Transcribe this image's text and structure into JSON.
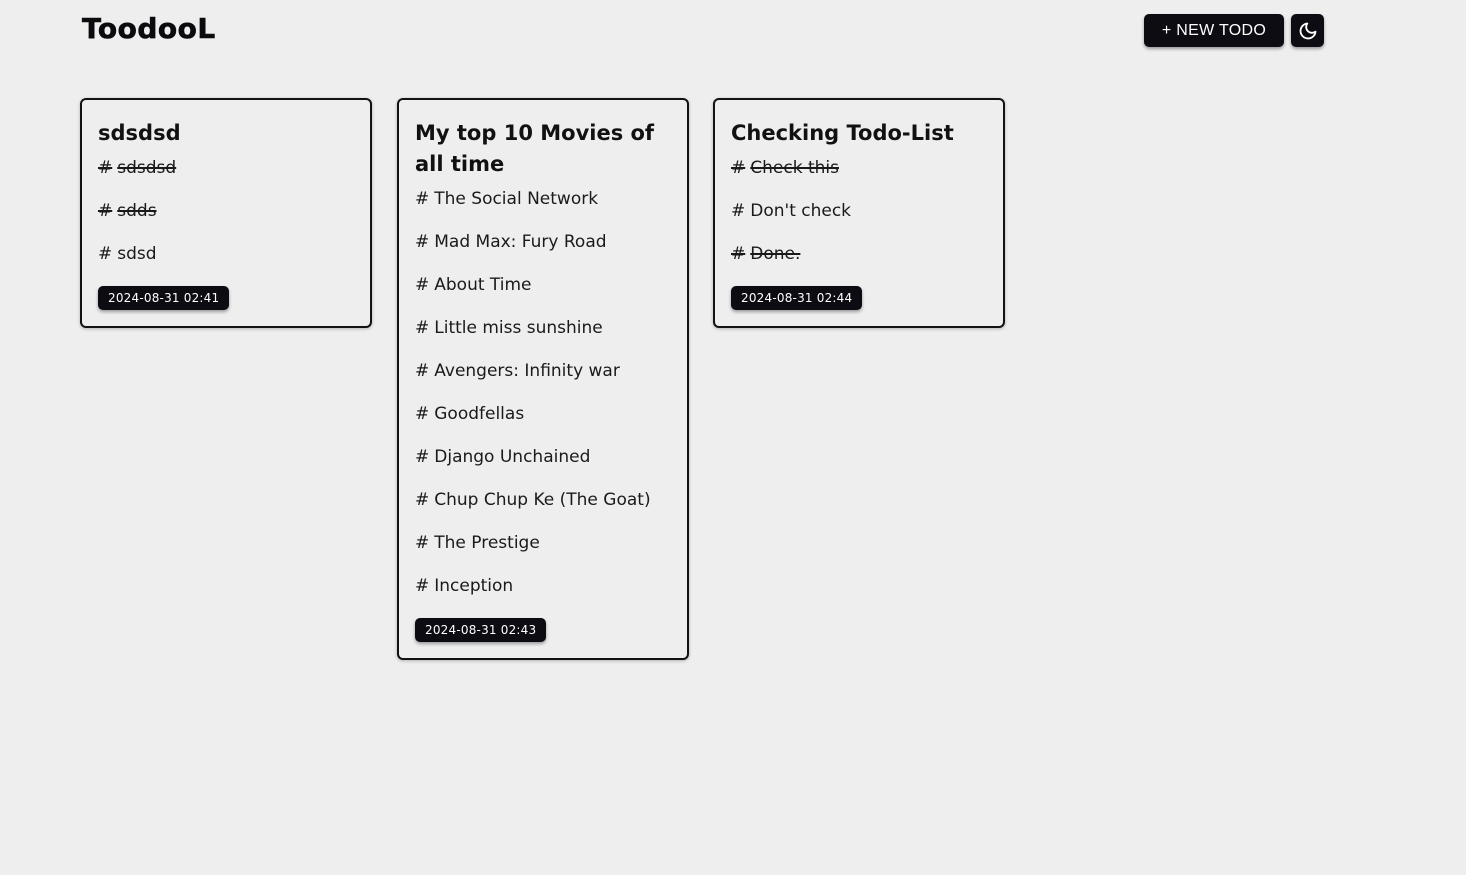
{
  "app": {
    "title": "ToodooL"
  },
  "header": {
    "new_todo_label": "+ NEW TODO",
    "theme_toggle_icon": "moon-icon"
  },
  "colors": {
    "background": "#eeeeee",
    "button_bg": "#0d0c12",
    "text": "#111111",
    "button_text": "#ffffff"
  },
  "todos": [
    {
      "title": "sdsdsd",
      "items": [
        {
          "text": "sdsdsd",
          "done": true
        },
        {
          "text": "sdds",
          "done": true
        },
        {
          "text": "sdsd",
          "done": false
        }
      ],
      "date": "2024-08-31 02:41"
    },
    {
      "title": "My top 10 Movies of all time",
      "items": [
        {
          "text": "The Social Network",
          "done": false
        },
        {
          "text": "Mad Max: Fury Road",
          "done": false
        },
        {
          "text": "About Time",
          "done": false
        },
        {
          "text": "Little miss sunshine",
          "done": false
        },
        {
          "text": "Avengers: Infinity war",
          "done": false
        },
        {
          "text": "Goodfellas",
          "done": false
        },
        {
          "text": "Django Unchained",
          "done": false
        },
        {
          "text": "Chup Chup Ke (The Goat)",
          "done": false
        },
        {
          "text": "The Prestige",
          "done": false
        },
        {
          "text": "Inception",
          "done": false
        }
      ],
      "date": "2024-08-31 02:43"
    },
    {
      "title": "Checking Todo-List",
      "items": [
        {
          "text": "Check this",
          "done": true
        },
        {
          "text": "Don't check",
          "done": false
        },
        {
          "text": "Done.",
          "done": true
        }
      ],
      "date": "2024-08-31 02:44"
    }
  ]
}
